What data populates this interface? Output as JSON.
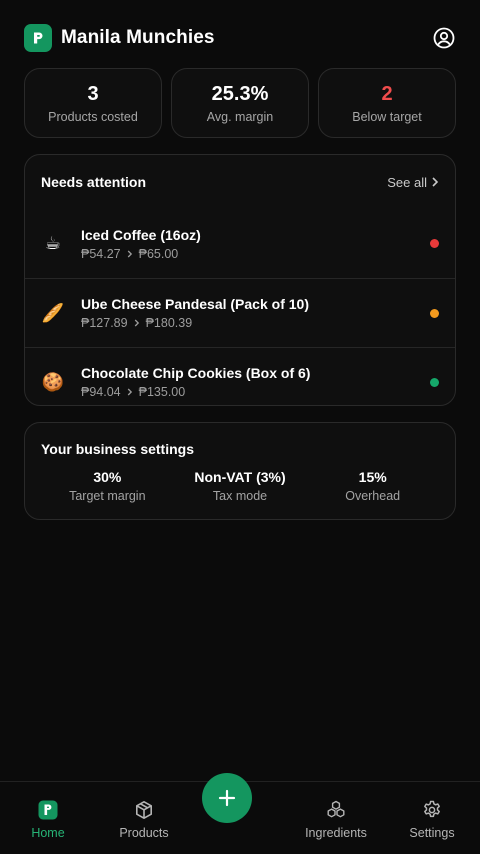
{
  "app": {
    "title": "Manila Munchies",
    "accent": "#14965f"
  },
  "stats": [
    {
      "value": "3",
      "label": "Products costed"
    },
    {
      "value": "25.3%",
      "label": "Avg. margin"
    },
    {
      "value": "2",
      "label": "Below target",
      "color": "#f04c4c"
    }
  ],
  "attention": {
    "title": "Needs attention",
    "see_all": "See all",
    "items": [
      {
        "emoji": "☕",
        "icon": "coffee-icon",
        "name": "Iced Coffee (16oz)",
        "cost": "₱54.27",
        "price": "₱65.00",
        "status": "red",
        "status_color": "#e83a3a"
      },
      {
        "emoji": "🥖",
        "icon": "bread-icon",
        "name": "Ube Cheese Pandesal (Pack of 10)",
        "cost": "₱127.89",
        "price": "₱180.39",
        "status": "orange",
        "status_color": "#f39a1e"
      },
      {
        "emoji": "🍪",
        "icon": "cookie-icon",
        "name": "Chocolate Chip Cookies (Box of 6)",
        "cost": "₱94.04",
        "price": "₱135.00",
        "status": "green",
        "status_color": "#15a86a"
      }
    ]
  },
  "business": {
    "title": "Your business settings",
    "settings": [
      {
        "value": "30%",
        "label": "Target margin"
      },
      {
        "value": "Non-VAT (3%)",
        "label": "Tax mode"
      },
      {
        "value": "15%",
        "label": "Overhead"
      }
    ]
  },
  "nav": {
    "items": [
      {
        "label": "Home",
        "icon": "home-icon",
        "active": true
      },
      {
        "label": "Products",
        "icon": "box-icon"
      },
      {
        "label": "Ingredients",
        "icon": "ingredients-icon"
      },
      {
        "label": "Settings",
        "icon": "gear-icon"
      }
    ],
    "fab_icon": "plus-icon"
  }
}
